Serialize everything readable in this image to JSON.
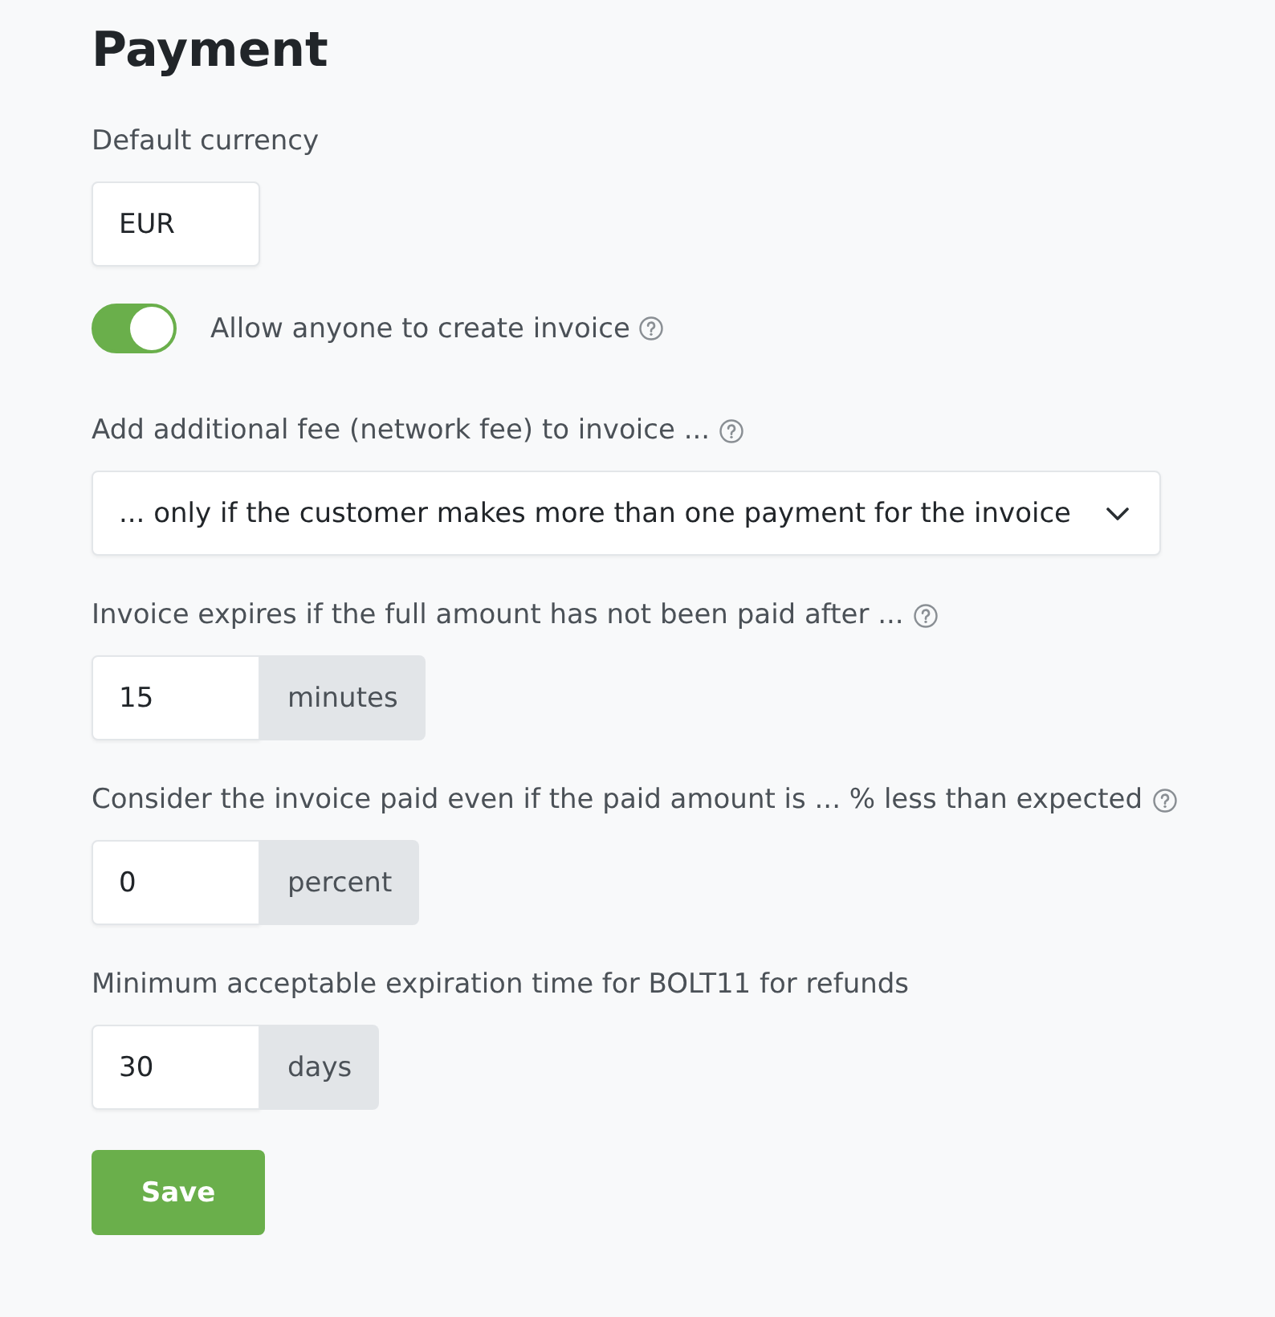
{
  "page": {
    "title": "Payment"
  },
  "fields": [
    {
      "kind": "text",
      "label": "Default currency",
      "value": "EUR",
      "help": false
    },
    {
      "kind": "toggle",
      "label": "Allow anyone to create invoice",
      "on": true,
      "help": true
    },
    {
      "kind": "select",
      "label": "Add additional fee (network fee) to invoice ...",
      "value": "... only if the customer makes more than one payment for the invoice",
      "help": true
    },
    {
      "kind": "unit",
      "label": "Invoice expires if the full amount has not been paid after ...",
      "value": "15",
      "unit": "minutes",
      "help": true
    },
    {
      "kind": "unit",
      "label": "Consider the invoice paid even if the paid amount is ... % less than expected",
      "value": "0",
      "unit": "percent",
      "help": true
    },
    {
      "kind": "unit",
      "label": "Minimum acceptable expiration time for BOLT11 for refunds",
      "value": "30",
      "unit": "days",
      "help": false
    }
  ],
  "save_button": {
    "label": "Save"
  }
}
